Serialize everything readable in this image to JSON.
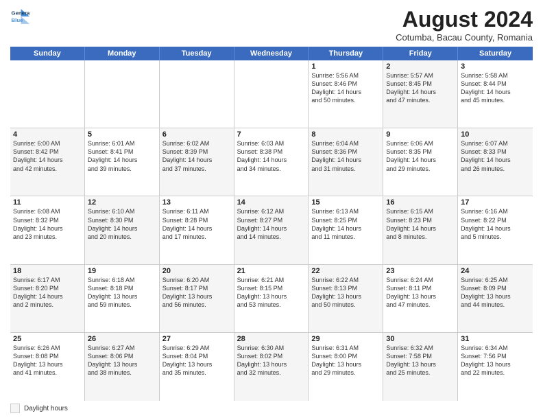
{
  "header": {
    "logo_line1": "General",
    "logo_line2": "Blue",
    "month_year": "August 2024",
    "location": "Cotumba, Bacau County, Romania"
  },
  "weekdays": [
    "Sunday",
    "Monday",
    "Tuesday",
    "Wednesday",
    "Thursday",
    "Friday",
    "Saturday"
  ],
  "weeks": [
    [
      {
        "day": "",
        "text": "",
        "shaded": false
      },
      {
        "day": "",
        "text": "",
        "shaded": false
      },
      {
        "day": "",
        "text": "",
        "shaded": false
      },
      {
        "day": "",
        "text": "",
        "shaded": false
      },
      {
        "day": "1",
        "text": "Sunrise: 5:56 AM\nSunset: 8:46 PM\nDaylight: 14 hours\nand 50 minutes.",
        "shaded": false
      },
      {
        "day": "2",
        "text": "Sunrise: 5:57 AM\nSunset: 8:45 PM\nDaylight: 14 hours\nand 47 minutes.",
        "shaded": true
      },
      {
        "day": "3",
        "text": "Sunrise: 5:58 AM\nSunset: 8:44 PM\nDaylight: 14 hours\nand 45 minutes.",
        "shaded": false
      }
    ],
    [
      {
        "day": "4",
        "text": "Sunrise: 6:00 AM\nSunset: 8:42 PM\nDaylight: 14 hours\nand 42 minutes.",
        "shaded": true
      },
      {
        "day": "5",
        "text": "Sunrise: 6:01 AM\nSunset: 8:41 PM\nDaylight: 14 hours\nand 39 minutes.",
        "shaded": false
      },
      {
        "day": "6",
        "text": "Sunrise: 6:02 AM\nSunset: 8:39 PM\nDaylight: 14 hours\nand 37 minutes.",
        "shaded": true
      },
      {
        "day": "7",
        "text": "Sunrise: 6:03 AM\nSunset: 8:38 PM\nDaylight: 14 hours\nand 34 minutes.",
        "shaded": false
      },
      {
        "day": "8",
        "text": "Sunrise: 6:04 AM\nSunset: 8:36 PM\nDaylight: 14 hours\nand 31 minutes.",
        "shaded": true
      },
      {
        "day": "9",
        "text": "Sunrise: 6:06 AM\nSunset: 8:35 PM\nDaylight: 14 hours\nand 29 minutes.",
        "shaded": false
      },
      {
        "day": "10",
        "text": "Sunrise: 6:07 AM\nSunset: 8:33 PM\nDaylight: 14 hours\nand 26 minutes.",
        "shaded": true
      }
    ],
    [
      {
        "day": "11",
        "text": "Sunrise: 6:08 AM\nSunset: 8:32 PM\nDaylight: 14 hours\nand 23 minutes.",
        "shaded": false
      },
      {
        "day": "12",
        "text": "Sunrise: 6:10 AM\nSunset: 8:30 PM\nDaylight: 14 hours\nand 20 minutes.",
        "shaded": true
      },
      {
        "day": "13",
        "text": "Sunrise: 6:11 AM\nSunset: 8:28 PM\nDaylight: 14 hours\nand 17 minutes.",
        "shaded": false
      },
      {
        "day": "14",
        "text": "Sunrise: 6:12 AM\nSunset: 8:27 PM\nDaylight: 14 hours\nand 14 minutes.",
        "shaded": true
      },
      {
        "day": "15",
        "text": "Sunrise: 6:13 AM\nSunset: 8:25 PM\nDaylight: 14 hours\nand 11 minutes.",
        "shaded": false
      },
      {
        "day": "16",
        "text": "Sunrise: 6:15 AM\nSunset: 8:23 PM\nDaylight: 14 hours\nand 8 minutes.",
        "shaded": true
      },
      {
        "day": "17",
        "text": "Sunrise: 6:16 AM\nSunset: 8:22 PM\nDaylight: 14 hours\nand 5 minutes.",
        "shaded": false
      }
    ],
    [
      {
        "day": "18",
        "text": "Sunrise: 6:17 AM\nSunset: 8:20 PM\nDaylight: 14 hours\nand 2 minutes.",
        "shaded": true
      },
      {
        "day": "19",
        "text": "Sunrise: 6:18 AM\nSunset: 8:18 PM\nDaylight: 13 hours\nand 59 minutes.",
        "shaded": false
      },
      {
        "day": "20",
        "text": "Sunrise: 6:20 AM\nSunset: 8:17 PM\nDaylight: 13 hours\nand 56 minutes.",
        "shaded": true
      },
      {
        "day": "21",
        "text": "Sunrise: 6:21 AM\nSunset: 8:15 PM\nDaylight: 13 hours\nand 53 minutes.",
        "shaded": false
      },
      {
        "day": "22",
        "text": "Sunrise: 6:22 AM\nSunset: 8:13 PM\nDaylight: 13 hours\nand 50 minutes.",
        "shaded": true
      },
      {
        "day": "23",
        "text": "Sunrise: 6:24 AM\nSunset: 8:11 PM\nDaylight: 13 hours\nand 47 minutes.",
        "shaded": false
      },
      {
        "day": "24",
        "text": "Sunrise: 6:25 AM\nSunset: 8:09 PM\nDaylight: 13 hours\nand 44 minutes.",
        "shaded": true
      }
    ],
    [
      {
        "day": "25",
        "text": "Sunrise: 6:26 AM\nSunset: 8:08 PM\nDaylight: 13 hours\nand 41 minutes.",
        "shaded": false
      },
      {
        "day": "26",
        "text": "Sunrise: 6:27 AM\nSunset: 8:06 PM\nDaylight: 13 hours\nand 38 minutes.",
        "shaded": true
      },
      {
        "day": "27",
        "text": "Sunrise: 6:29 AM\nSunset: 8:04 PM\nDaylight: 13 hours\nand 35 minutes.",
        "shaded": false
      },
      {
        "day": "28",
        "text": "Sunrise: 6:30 AM\nSunset: 8:02 PM\nDaylight: 13 hours\nand 32 minutes.",
        "shaded": true
      },
      {
        "day": "29",
        "text": "Sunrise: 6:31 AM\nSunset: 8:00 PM\nDaylight: 13 hours\nand 29 minutes.",
        "shaded": false
      },
      {
        "day": "30",
        "text": "Sunrise: 6:32 AM\nSunset: 7:58 PM\nDaylight: 13 hours\nand 25 minutes.",
        "shaded": true
      },
      {
        "day": "31",
        "text": "Sunrise: 6:34 AM\nSunset: 7:56 PM\nDaylight: 13 hours\nand 22 minutes.",
        "shaded": false
      }
    ]
  ],
  "legend": {
    "label": "Daylight hours"
  }
}
